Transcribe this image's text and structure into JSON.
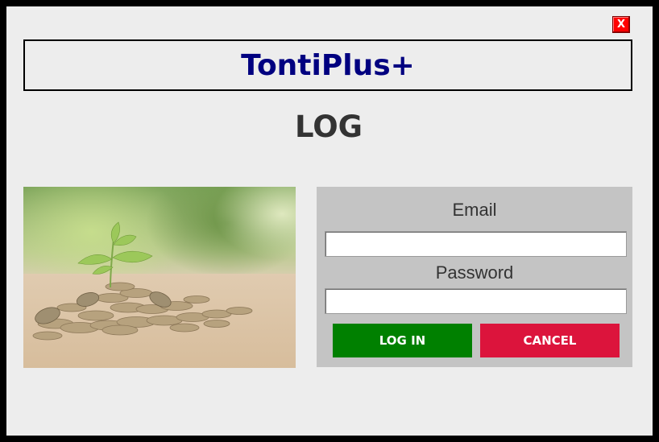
{
  "window": {
    "close_label": "X"
  },
  "header": {
    "app_title": "TontiPlus+"
  },
  "page": {
    "heading": "LOG"
  },
  "form": {
    "email_label": "Email",
    "email_value": "",
    "password_label": "Password",
    "password_value": "",
    "login_label": "LOG IN",
    "cancel_label": "CANCEL"
  },
  "colors": {
    "title_text": "#000080",
    "login_button": "#008000",
    "cancel_button": "#dc143c",
    "close_button": "#ff0000",
    "panel_background": "#c4c4c4",
    "window_background": "#ededed"
  },
  "image": {
    "subject": "plant-sprouting-from-coins-photo"
  }
}
